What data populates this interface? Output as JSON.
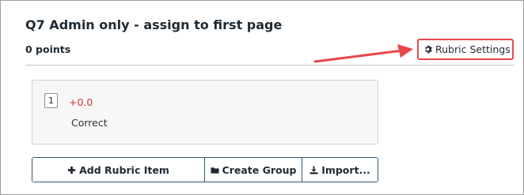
{
  "question": {
    "title": "Q7 Admin only - assign to first page",
    "points": "0 points"
  },
  "rubric_settings": {
    "label": "Rubric Settings",
    "icon": "gear-icon"
  },
  "annotation": {
    "arrow_color": "#e8474a",
    "highlight_color": "#e8474a"
  },
  "rubric_items": [
    {
      "key": "1",
      "points": "+0.0",
      "description": "Correct"
    }
  ],
  "actions": {
    "add_label": "Add Rubric Item",
    "add_icon": "plus-icon",
    "group_label": "Create Group",
    "group_icon": "folder-icon",
    "import_label": "Import...",
    "import_icon": "download-icon"
  },
  "colors": {
    "points_positive": "#d0323c",
    "button_border": "#2d5873"
  }
}
